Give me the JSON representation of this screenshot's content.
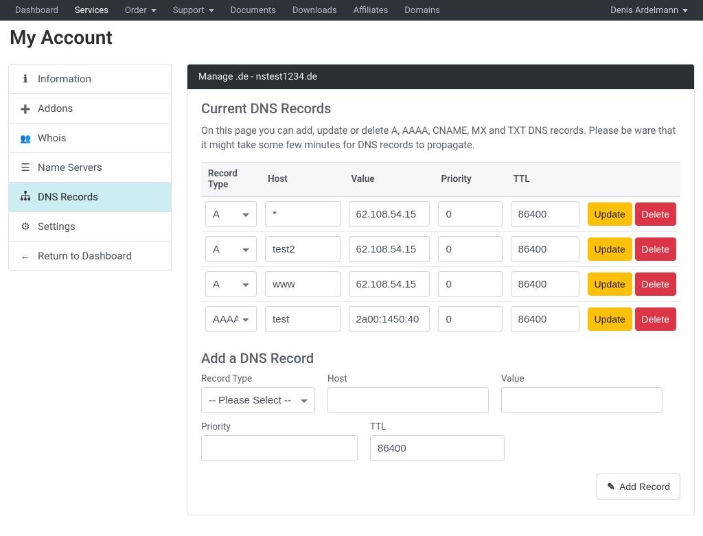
{
  "topnav": {
    "items": [
      {
        "label": "Dashboard"
      },
      {
        "label": "Services"
      },
      {
        "label": "Order"
      },
      {
        "label": "Support"
      },
      {
        "label": "Documents"
      },
      {
        "label": "Downloads"
      },
      {
        "label": "Affiliates"
      },
      {
        "label": "Domains"
      }
    ],
    "user": "Denis Ardelmann"
  },
  "page_title": "My Account",
  "sidebar": {
    "items": [
      {
        "label": "Information"
      },
      {
        "label": "Addons"
      },
      {
        "label": "Whois"
      },
      {
        "label": "Name Servers"
      },
      {
        "label": "DNS Records"
      },
      {
        "label": "Settings"
      },
      {
        "label": "Return to Dashboard"
      }
    ]
  },
  "card": {
    "header": "Manage .de - nstest1234.de",
    "section_title": "Current DNS Records",
    "description": "On this page you can add, update or delete A, AAAA, CNAME, MX and TXT DNS records. Please be ware that it might take some few minutes for DNS records to propagate.",
    "columns": {
      "type": "Record Type",
      "host": "Host",
      "value": "Value",
      "priority": "Priority",
      "ttl": "TTL"
    },
    "buttons": {
      "update": "Update",
      "delete": "Delete"
    },
    "rows": [
      {
        "type": "A",
        "host": "*",
        "value": "62.108.54.15",
        "priority": "0",
        "ttl": "86400"
      },
      {
        "type": "A",
        "host": "test2",
        "value": "62.108.54.15",
        "priority": "0",
        "ttl": "86400"
      },
      {
        "type": "A",
        "host": "www",
        "value": "62.108.54.15",
        "priority": "0",
        "ttl": "86400"
      },
      {
        "type": "AAAA",
        "host": "test",
        "value": "2a00:1450:40",
        "priority": "0",
        "ttl": "86400"
      }
    ]
  },
  "add": {
    "title": "Add a DNS Record",
    "labels": {
      "type": "Record Type",
      "host": "Host",
      "value": "Value",
      "priority": "Priority",
      "ttl": "TTL"
    },
    "type_placeholder": "-- Please Select --",
    "ttl_default": "86400",
    "button": "Add Record"
  }
}
